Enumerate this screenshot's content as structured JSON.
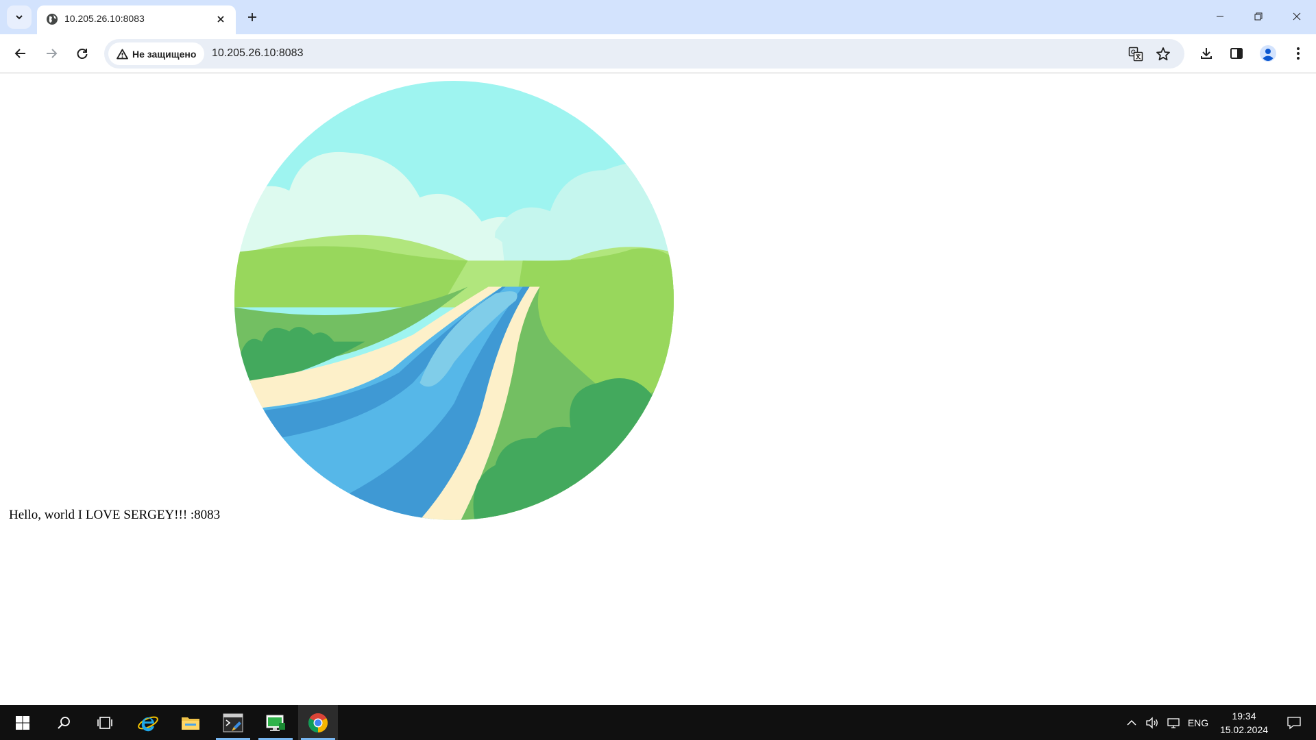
{
  "browser": {
    "tab": {
      "title": "10.205.26.10:8083"
    },
    "omnibox": {
      "security_label": "Не защищено",
      "url": "10.205.26.10:8083"
    },
    "accent_color": "#d3e3fd"
  },
  "page": {
    "message": "Hello, world I LOVE SERGEY!!! :8083"
  },
  "taskbar": {
    "items": [
      "start-icon",
      "search-icon",
      "task-view-icon",
      "internet-explorer-icon",
      "file-explorer-icon",
      "terminal-icon",
      "remote-desktop-icon",
      "chrome-icon"
    ],
    "tray": {
      "language": "ENG",
      "time": "19:34",
      "date": "15.02.2024"
    }
  }
}
